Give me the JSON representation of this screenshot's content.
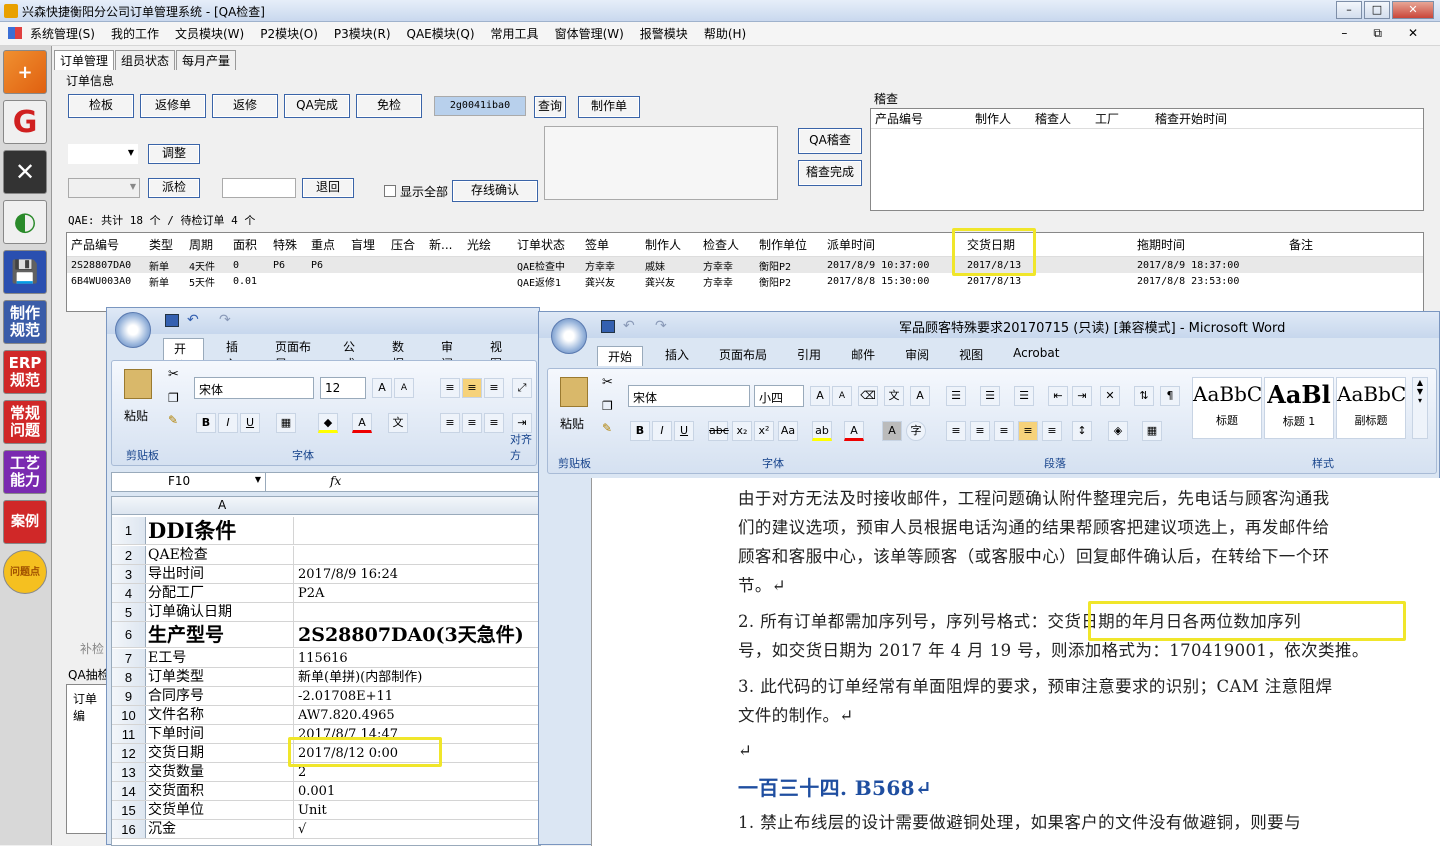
{
  "app": {
    "title": "兴森快捷衡阳分公司订单管理系统 - [QA检查]",
    "win_buttons": [
      "–",
      "□",
      "✕"
    ],
    "menu": [
      "系统管理(S)",
      "我的工作",
      "文员模块(W)",
      "P2模块(O)",
      "P3模块(R)",
      "QAE模块(Q)",
      "常用工具",
      "窗体管理(W)",
      "报警模块",
      "帮助(H)"
    ],
    "menu_controls": [
      "–",
      "⧉",
      "✕"
    ]
  },
  "sidebar": {
    "items": [
      "G",
      "✕",
      "◐",
      "💾",
      "制作规范",
      "ERP规范",
      "常规问题",
      "工艺能力",
      "案例",
      "问题点"
    ]
  },
  "tabs": [
    "订单管理",
    "组员状态",
    "每月产量"
  ],
  "order_info": {
    "group_title": "订单信息",
    "buttons": [
      "检板",
      "返修单",
      "返修",
      "QA完成",
      "免检"
    ],
    "search_value": "2g0041iba0",
    "query_button": "查询",
    "make_order_button": "制作单",
    "adjust_button": "调整",
    "dispatch_button": "派检",
    "return_button": "退回",
    "show_all_label": "显示全部",
    "archive_button": "存线确认",
    "qa_audit_button": "QA稽查",
    "audit_done_button": "稽查完成",
    "summary": "QAE: 共计 18 个 / 待检订单 4 个"
  },
  "audit": {
    "title": "稽查",
    "columns": [
      "产品编号",
      "制作人",
      "稽查人",
      "工厂",
      "稽查开始时间"
    ]
  },
  "orders": {
    "columns": [
      "产品编号",
      "类型",
      "周期",
      "面积",
      "特殊",
      "重点",
      "盲埋",
      "压合",
      "新...",
      "光绘",
      "订单状态",
      "签单",
      "制作人",
      "检查人",
      "制作单位",
      "派单时间",
      "交货日期",
      "拖期时间",
      "备注"
    ],
    "rows": [
      [
        "2S28807DA0",
        "新单",
        "4天件",
        "0",
        "P6",
        "P6",
        "",
        "",
        "",
        "",
        "QAE检查中",
        "方幸幸",
        "戚妹",
        "方幸幸",
        "衡阳P2",
        "2017/8/9 10:37:00",
        "2017/8/13",
        "2017/8/9 18:37:00",
        ""
      ],
      [
        "6B4WU003A0",
        "新单",
        "5天件",
        "0.01",
        "",
        "",
        "",
        "",
        "",
        "",
        "QAE返修1",
        "龚兴友",
        "龚兴友",
        "方幸幸",
        "衡阳P2",
        "2017/8/8 15:30:00",
        "2017/8/13",
        "2017/8/8 23:53:00",
        ""
      ]
    ]
  },
  "lower_left": {
    "check_label": "补检",
    "qa_label": "QA抽检",
    "col_label": "订单编"
  },
  "excel": {
    "tabs": [
      "开始",
      "插入",
      "页面布局",
      "公式",
      "数据",
      "审阅",
      "视图"
    ],
    "font_name": "宋体",
    "font_size": "12",
    "clipboard_label": "剪贴板",
    "font_label": "字体",
    "align_label": "对齐方",
    "paste_label": "粘贴",
    "name_box": "F10",
    "fx": "fx",
    "col_a": "A",
    "rows": [
      {
        "n": "1",
        "a": "DDI条件",
        "b": ""
      },
      {
        "n": "2",
        "a": "QAE检查",
        "b": ""
      },
      {
        "n": "3",
        "a": "导出时间",
        "b": "2017/8/9 16:24"
      },
      {
        "n": "4",
        "a": "分配工厂",
        "b": "P2A"
      },
      {
        "n": "5",
        "a": "订单确认日期",
        "b": ""
      },
      {
        "n": "6",
        "a": "生产型号",
        "b": "2S28807DA0(3天急件)"
      },
      {
        "n": "7",
        "a": "E工号",
        "b": "115616"
      },
      {
        "n": "8",
        "a": "订单类型",
        "b": "新单(单拼)(内部制作)"
      },
      {
        "n": "9",
        "a": "合同序号",
        "b": "-2.01708E+11"
      },
      {
        "n": "10",
        "a": "文件名称",
        "b": "AW7.820.4965"
      },
      {
        "n": "11",
        "a": "下单时间",
        "b": "2017/8/7 14:47"
      },
      {
        "n": "12",
        "a": "交货日期",
        "b": "2017/8/12 0:00"
      },
      {
        "n": "13",
        "a": "交货数量",
        "b": "2"
      },
      {
        "n": "14",
        "a": "交货面积",
        "b": "0.001"
      },
      {
        "n": "15",
        "a": "交货单位",
        "b": "Unit"
      },
      {
        "n": "16",
        "a": "沉金",
        "b": "√"
      }
    ]
  },
  "word": {
    "title": "军品顾客特殊要求20170715 (只读) [兼容模式] - Microsoft Word",
    "tabs": [
      "开始",
      "插入",
      "页面布局",
      "引用",
      "邮件",
      "审阅",
      "视图",
      "Acrobat"
    ],
    "font_name": "宋体",
    "font_size": "小四",
    "paste_label": "粘贴",
    "clipboard_label": "剪贴板",
    "font_label": "字体",
    "para_label": "段落",
    "styles_label": "样式",
    "styles": [
      {
        "preview": "AaBbC",
        "name": "标题"
      },
      {
        "preview": "AaBl",
        "name": "标题 1"
      },
      {
        "preview": "AaBbC",
        "name": "副标题"
      }
    ],
    "paragraphs": [
      "由于对方无法及时接收邮件，工程问题确认附件整理完后，先电话与顾客沟通我",
      "们的建议选项，预审人员根据电话沟通的结果帮顾客把建议项选上，再发邮件给",
      "顾客和客服中心，该单等顾客（或客服中心）回复邮件确认后，在转给下一个环",
      "节。↵",
      "2.  所有订单都需加序列号，序列号格式：交货日期的年月日各两位数加序列",
      "号，如交货日期为 2017 年 4 月 19 号，则添加格式为：170419001，依次类推。",
      "3.  此代码的订单经常有单面阻焊的要求，预审注意要求的识别；CAM 注意阻焊",
      "文件的制作。↵",
      "↵",
      "1.  禁止布线层的设计需要做避铜处理，如果客户的文件没有做避铜，则要与"
    ],
    "heading": "一百三十四. B568↵"
  }
}
